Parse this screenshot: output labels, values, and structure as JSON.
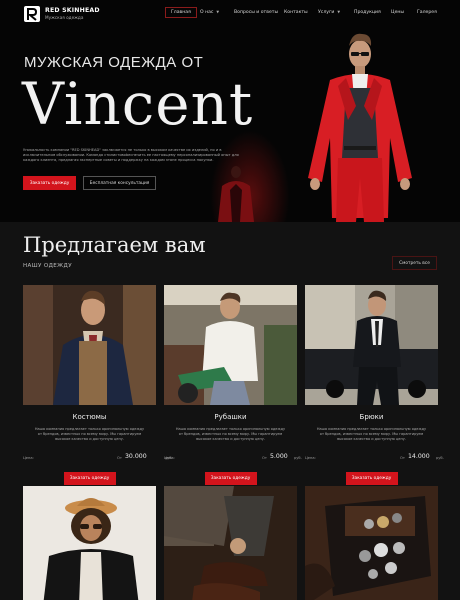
{
  "brand": {
    "name": "RED SKINHEAD",
    "tagline": "Мужская одежда"
  },
  "nav": {
    "items": [
      {
        "label": "Главная",
        "active": true
      },
      {
        "label": "О нас",
        "dropdown": true
      },
      {
        "label": "Вопросы и ответы"
      },
      {
        "label": "Контакты"
      },
      {
        "label": "Услуги",
        "dropdown": true
      },
      {
        "label": "Продукция"
      },
      {
        "label": "Цены"
      },
      {
        "label": "Галерея"
      }
    ]
  },
  "hero": {
    "subtitle": "МУЖСКАЯ ОДЕЖДА ОТ",
    "title": "Vincent",
    "description": "Уникальность компании \"RED SKINHEAD\" заключается не только в высоком качестве их изделий, но и в исключительном обслуживании. Команда стилистовobeспечить ее настоящему персонализированный опыт для каждого клиента, предлагая экспертные советы и поддержку на каждом этапе процесса покупки.",
    "primary_button": "Заказать одежду",
    "secondary_button": "Бесплатная консультация"
  },
  "offer": {
    "title": "Предлагаем вам",
    "subtitle": "НАШУ ОДЕЖДУ",
    "view_all": "Смотреть все"
  },
  "products": [
    {
      "name": "Костюмы",
      "description": "Наша компания предлагает только оригинальную одежду от брендов, известных по всему миру. Мы гарантируем высокое качество и доступную цену.",
      "price_label": "Цена:",
      "price_from": "От",
      "price": "30.000",
      "currency": "руб.",
      "button": "Заказать одежду"
    },
    {
      "name": "Рубашки",
      "description": "Наша компания предлагает только оригинальную одежду от брендов, известных по всему миру. Мы гарантируем высокое качество и доступную цену.",
      "price_label": "Цена:",
      "price_from": "От",
      "price": "5.000",
      "currency": "руб.",
      "button": "Заказать одежду"
    },
    {
      "name": "Брюки",
      "description": "Наша компания предлагает только оригинальную одежду от брендов, известных по всему миру. Мы гарантируем высокое качество и доступную цену.",
      "price_label": "Цена:",
      "price_from": "От",
      "price": "14.000",
      "currency": "руб.",
      "button": "Заказать одежду"
    }
  ],
  "colors": {
    "accent": "#d3141c",
    "background": "#121212",
    "hero_background": "#050505"
  }
}
